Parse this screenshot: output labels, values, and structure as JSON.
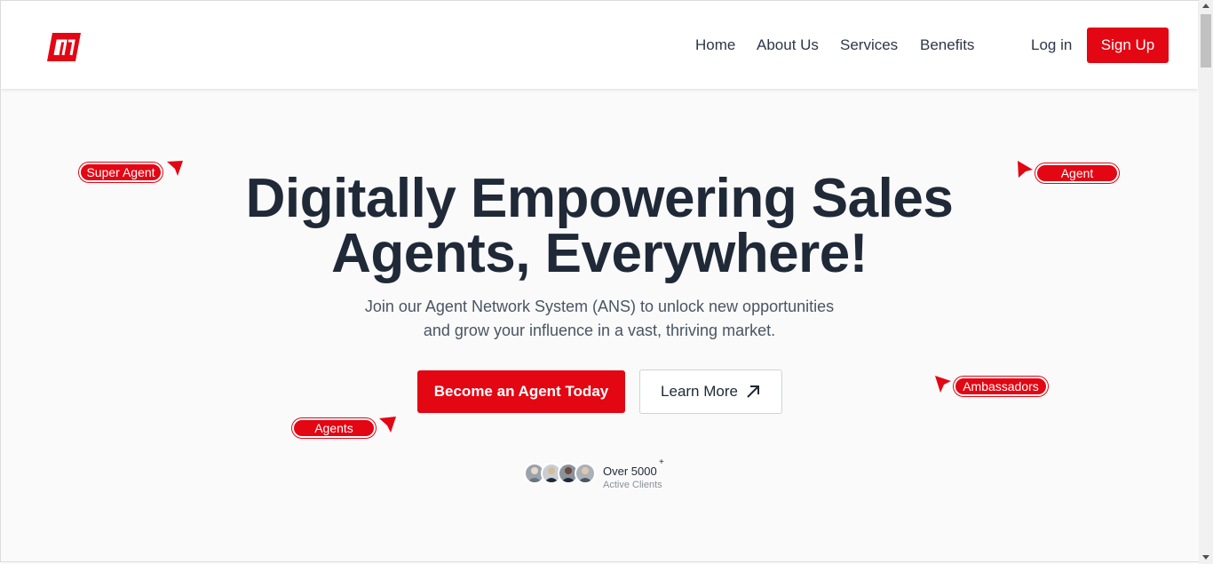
{
  "header": {
    "logo_icon": "mi-logo-icon",
    "nav": {
      "home": "Home",
      "about": "About Us",
      "services": "Services",
      "benefits": "Benefits"
    },
    "login_label": "Log in",
    "signup_label": "Sign Up"
  },
  "hero": {
    "title_line1": "Digitally Empowering Sales",
    "title_line2": "Agents, Everywhere!",
    "subtitle_line1": "Join our Agent Network System (ANS) to unlock new opportunities",
    "subtitle_line2": "and grow your influence in a vast, thriving market.",
    "primary_cta": "Become an Agent Today",
    "secondary_cta": "Learn More",
    "secondary_cta_icon": "arrow-up-right-icon"
  },
  "tags": {
    "super_agent": "Super Agent",
    "agent": "Agent",
    "ambassadors": "Ambassadors",
    "agents": "Agents"
  },
  "clients": {
    "count": "Over 5000",
    "plus": "+",
    "label": "Active Clients"
  },
  "colors": {
    "brand_red": "#e30613",
    "heading": "#1f2937",
    "body_text": "#4a5563"
  }
}
